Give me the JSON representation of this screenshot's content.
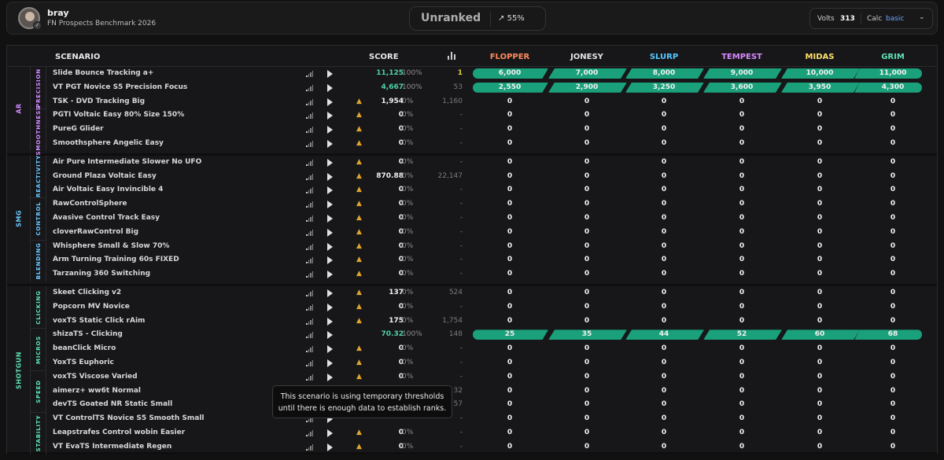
{
  "profile": {
    "username": "bray",
    "benchmark": "FN Prospects Benchmark 2026",
    "badge_icon": "check-badge-icon"
  },
  "rank": {
    "label": "Unranked",
    "progress": "55%"
  },
  "stats": {
    "volts_label": "Volts",
    "volts_value": "313",
    "calc_label": "Calc",
    "calc_value": "basic"
  },
  "table": {
    "col_scenario": "SCENARIO",
    "col_score": "SCORE",
    "tiers": [
      {
        "name": "FLOPPER",
        "color": "#ff8a5c"
      },
      {
        "name": "JONESY",
        "color": "#e4e4e4"
      },
      {
        "name": "SLURP",
        "color": "#57c8ff"
      },
      {
        "name": "TEMPEST",
        "color": "#d98aff"
      },
      {
        "name": "MIDAS",
        "color": "#ffe16b"
      },
      {
        "name": "GRIM",
        "color": "#5fe3b2"
      }
    ]
  },
  "categories": [
    {
      "name": "AR",
      "color": "#d58bff",
      "subs": [
        {
          "name": "PRECISION",
          "color": "#d58bff"
        },
        {
          "name": "SMOOTHNESS",
          "color": "#d58bff"
        }
      ]
    },
    {
      "name": "SMG",
      "color": "#6bc9ff",
      "subs": [
        {
          "name": "REACTIVITY",
          "color": "#6bc9ff"
        },
        {
          "name": "CONTROL",
          "color": "#6bc9ff"
        },
        {
          "name": "BLENDING",
          "color": "#6bc9ff"
        }
      ]
    },
    {
      "name": "SHOTGUN",
      "color": "#5fe3b2",
      "subs": [
        {
          "name": "CLICKING",
          "color": "#5fe3b2"
        },
        {
          "name": "MICROS",
          "color": "#5fe3b2"
        },
        {
          "name": "SPEED",
          "color": "#5fe3b2"
        },
        {
          "name": "STABILITY",
          "color": "#5fe3b2"
        }
      ]
    }
  ],
  "rows": [
    {
      "name": "Slide Bounce Tracking a+",
      "score": "11,125",
      "pct": "100%",
      "rank": "1",
      "warn": false,
      "filled": true,
      "tiers": [
        "6,000",
        "7,000",
        "8,000",
        "9,000",
        "10,000",
        "11,000"
      ]
    },
    {
      "name": "VT PGT Novice S5 Precision Focus",
      "score": "4,667",
      "pct": "100%",
      "rank": "53",
      "warn": false,
      "filled": true,
      "tiers": [
        "2,550",
        "2,900",
        "3,250",
        "3,600",
        "3,950",
        "4,300"
      ]
    },
    {
      "name": "TSK - DVD Tracking Big",
      "score": "1,954",
      "pct": "0%",
      "rank": "1,160",
      "warn": true,
      "filled": false,
      "tiers": [
        "0",
        "0",
        "0",
        "0",
        "0",
        "0"
      ]
    },
    {
      "name": "PGTI Voltaic Easy 80% Size 150%",
      "score": "0",
      "pct": "0%",
      "rank": "-",
      "warn": true,
      "filled": false,
      "tiers": [
        "0",
        "0",
        "0",
        "0",
        "0",
        "0"
      ]
    },
    {
      "name": "PureG Glider",
      "score": "0",
      "pct": "0%",
      "rank": "-",
      "warn": true,
      "filled": false,
      "tiers": [
        "0",
        "0",
        "0",
        "0",
        "0",
        "0"
      ]
    },
    {
      "name": "Smoothsphere Angelic Easy",
      "score": "0",
      "pct": "0%",
      "rank": "-",
      "warn": true,
      "filled": false,
      "tiers": [
        "0",
        "0",
        "0",
        "0",
        "0",
        "0"
      ]
    },
    {
      "name": "Air Pure Intermediate Slower No UFO",
      "score": "0",
      "pct": "0%",
      "rank": "-",
      "warn": true,
      "filled": false,
      "tiers": [
        "0",
        "0",
        "0",
        "0",
        "0",
        "0"
      ]
    },
    {
      "name": "Ground Plaza Voltaic Easy",
      "score": "870.88",
      "pct": "0%",
      "rank": "22,147",
      "warn": true,
      "filled": false,
      "tiers": [
        "0",
        "0",
        "0",
        "0",
        "0",
        "0"
      ]
    },
    {
      "name": "Air Voltaic Easy Invincible 4",
      "score": "0",
      "pct": "0%",
      "rank": "-",
      "warn": true,
      "filled": false,
      "tiers": [
        "0",
        "0",
        "0",
        "0",
        "0",
        "0"
      ]
    },
    {
      "name": "RawControlSphere",
      "score": "0",
      "pct": "0%",
      "rank": "-",
      "warn": true,
      "filled": false,
      "tiers": [
        "0",
        "0",
        "0",
        "0",
        "0",
        "0"
      ]
    },
    {
      "name": "Avasive Control Track Easy",
      "score": "0",
      "pct": "0%",
      "rank": "-",
      "warn": true,
      "filled": false,
      "tiers": [
        "0",
        "0",
        "0",
        "0",
        "0",
        "0"
      ]
    },
    {
      "name": "cloverRawControl Big",
      "score": "0",
      "pct": "0%",
      "rank": "-",
      "warn": true,
      "filled": false,
      "tiers": [
        "0",
        "0",
        "0",
        "0",
        "0",
        "0"
      ]
    },
    {
      "name": "Whisphere Small & Slow 70%",
      "score": "0",
      "pct": "0%",
      "rank": "-",
      "warn": true,
      "filled": false,
      "tiers": [
        "0",
        "0",
        "0",
        "0",
        "0",
        "0"
      ]
    },
    {
      "name": "Arm Turning Training 60s FIXED",
      "score": "0",
      "pct": "0%",
      "rank": "-",
      "warn": true,
      "filled": false,
      "tiers": [
        "0",
        "0",
        "0",
        "0",
        "0",
        "0"
      ]
    },
    {
      "name": "Tarzaning 360 Switching",
      "score": "0",
      "pct": "0%",
      "rank": "-",
      "warn": true,
      "filled": false,
      "tiers": [
        "0",
        "0",
        "0",
        "0",
        "0",
        "0"
      ]
    },
    {
      "name": "Skeet Clicking v2",
      "score": "137",
      "pct": "0%",
      "rank": "524",
      "warn": true,
      "filled": false,
      "tiers": [
        "0",
        "0",
        "0",
        "0",
        "0",
        "0"
      ]
    },
    {
      "name": "Popcorn MV Novice",
      "score": "0",
      "pct": "0%",
      "rank": "-",
      "warn": true,
      "filled": false,
      "tiers": [
        "0",
        "0",
        "0",
        "0",
        "0",
        "0"
      ]
    },
    {
      "name": "voxTS Static Click rAim",
      "score": "175",
      "pct": "0%",
      "rank": "1,754",
      "warn": true,
      "filled": false,
      "tiers": [
        "0",
        "0",
        "0",
        "0",
        "0",
        "0"
      ]
    },
    {
      "name": "shizaTS - Clicking",
      "score": "70.32",
      "pct": "100%",
      "rank": "148",
      "warn": false,
      "filled": true,
      "tiers": [
        "25",
        "35",
        "44",
        "52",
        "60",
        "68"
      ]
    },
    {
      "name": "beanClick Micro",
      "score": "0",
      "pct": "0%",
      "rank": "-",
      "warn": true,
      "filled": false,
      "tiers": [
        "0",
        "0",
        "0",
        "0",
        "0",
        "0"
      ]
    },
    {
      "name": "YoxTS Euphoric",
      "score": "0",
      "pct": "0%",
      "rank": "-",
      "warn": true,
      "filled": false,
      "tiers": [
        "0",
        "0",
        "0",
        "0",
        "0",
        "0"
      ]
    },
    {
      "name": "voxTS Viscose Varied",
      "score": "0",
      "pct": "0%",
      "rank": "-",
      "warn": true,
      "filled": false,
      "tiers": [
        "0",
        "0",
        "0",
        "0",
        "0",
        "0"
      ]
    },
    {
      "name": "aimerz+ ww6t Normal",
      "score": "",
      "pct": "",
      "rank": "32",
      "warn": false,
      "filled": false,
      "tiers": [
        "0",
        "0",
        "0",
        "0",
        "0",
        "0"
      ]
    },
    {
      "name": "devTS Goated NR Static Small",
      "score": "",
      "pct": "",
      "rank": "57",
      "warn": false,
      "filled": false,
      "tiers": [
        "0",
        "0",
        "0",
        "0",
        "0",
        "0"
      ]
    },
    {
      "name": "VT ControlTS Novice S5 Smooth Small",
      "score": "",
      "pct": "",
      "rank": "-",
      "warn": false,
      "filled": false,
      "tiers": [
        "0",
        "0",
        "0",
        "0",
        "0",
        "0"
      ]
    },
    {
      "name": "Leapstrafes Control wobin Easier",
      "score": "0",
      "pct": "0%",
      "rank": "-",
      "warn": true,
      "filled": false,
      "tiers": [
        "0",
        "0",
        "0",
        "0",
        "0",
        "0"
      ]
    },
    {
      "name": "VT EvaTS Intermediate Regen",
      "score": "0",
      "pct": "0%",
      "rank": "-",
      "warn": true,
      "filled": false,
      "tiers": [
        "0",
        "0",
        "0",
        "0",
        "0",
        "0"
      ]
    }
  ],
  "tooltip": {
    "line1": "This scenario is using temporary thresholds",
    "line2": "until there is enough data to establish ranks."
  }
}
